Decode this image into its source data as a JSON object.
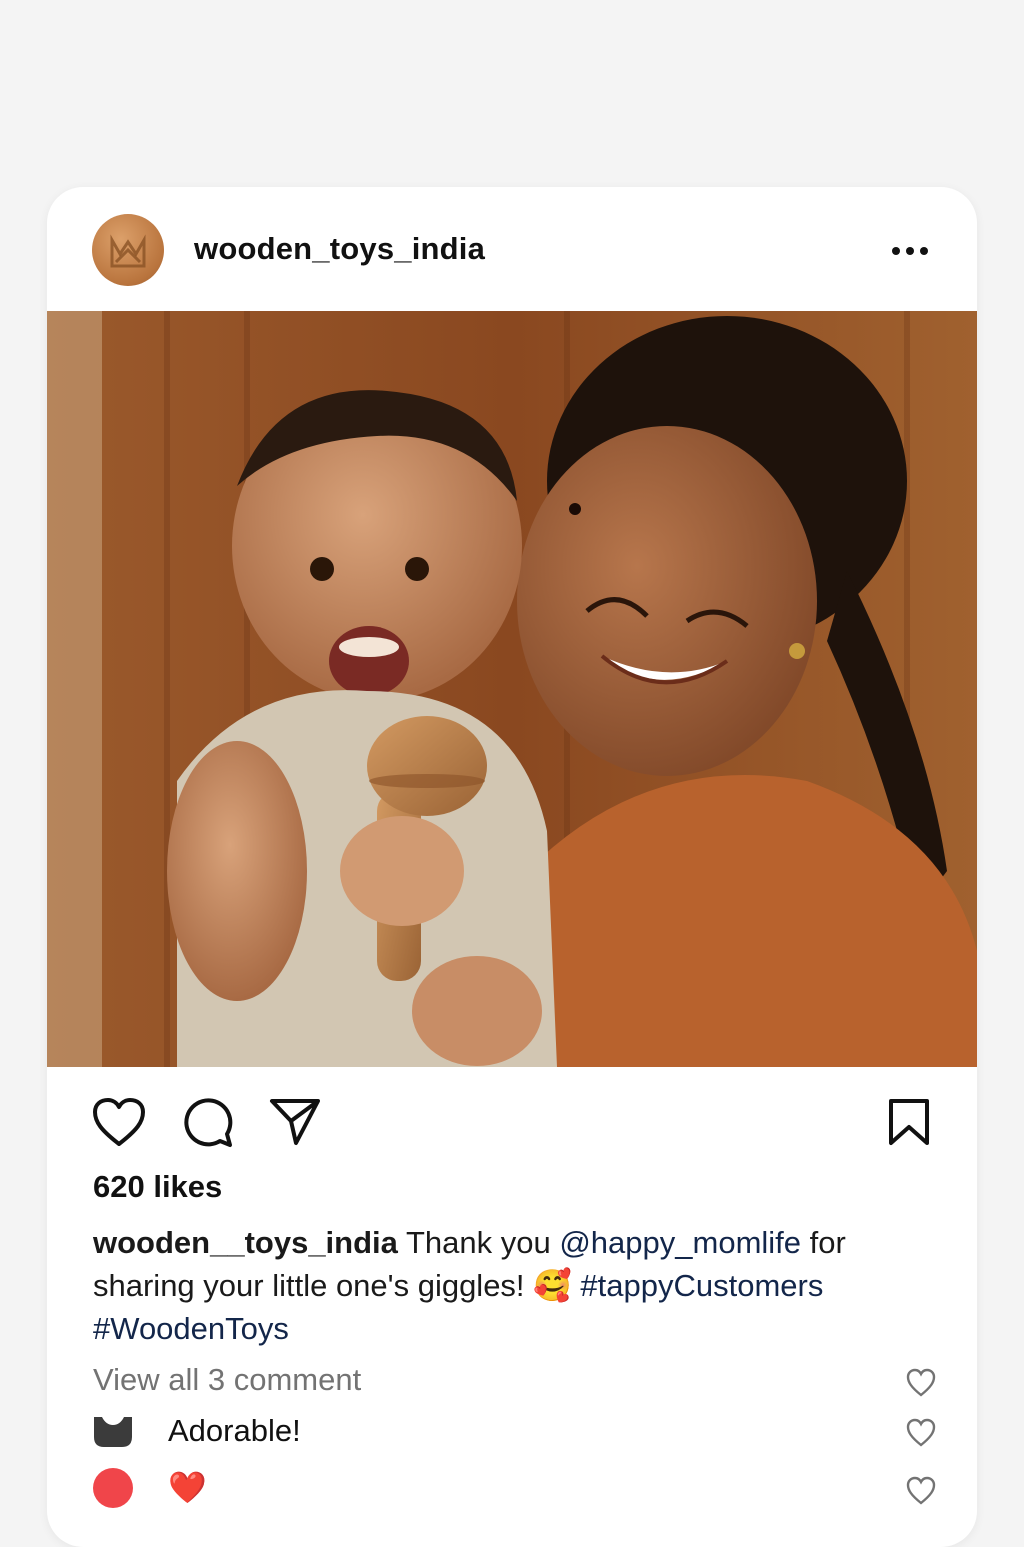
{
  "post": {
    "username": "wooden_toys_india",
    "likes": "620 likes",
    "caption": {
      "username": "wooden__toys_india",
      "text_1": " Thank you ",
      "mention": "@happy_momlife",
      "text_2": " for sharing your little one's giggles! ",
      "emoji": "🥰",
      "hashtag_1": " #tappyCustomers",
      "hashtag_2": "#WoodenToys"
    },
    "view_all_comments": "View all 3 comment",
    "comments": [
      {
        "text": "Adorable!"
      },
      {
        "text": "❤️"
      }
    ]
  },
  "icons": {
    "more": "more-options-icon",
    "like": "heart-icon",
    "comment": "comment-icon",
    "share": "send-icon",
    "save": "bookmark-icon"
  },
  "colors": {
    "background": "#f4f4f4",
    "card": "#ffffff",
    "secondary_text": "#737373",
    "red_avatar": "#f0454a"
  }
}
